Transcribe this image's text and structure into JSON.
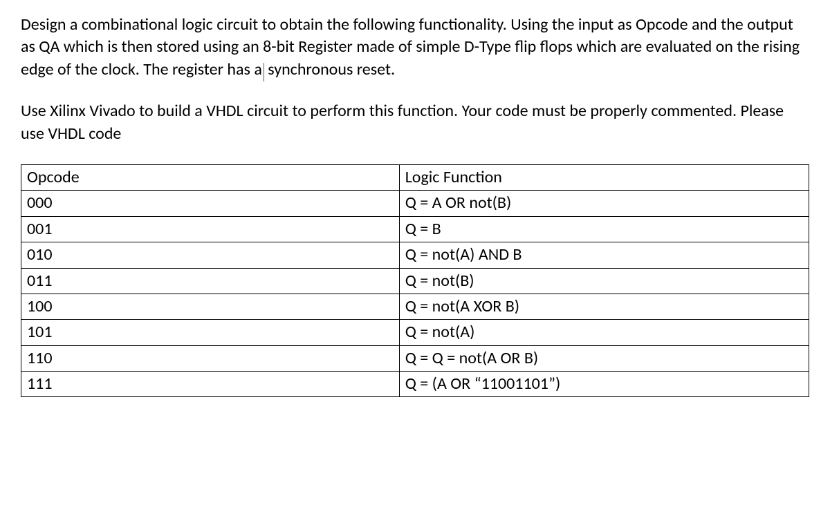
{
  "paragraphs": {
    "p1_part1": "Design a combinational logic circuit to obtain the following functionality. Using the input as Opcode and the output as QA which is then stored using an 8-bit Register made of simple D-Type flip flops which are evaluated on the rising edge of the clock. The register has a",
    "p1_part2": "synchronous reset.",
    "p2": "Use Xilinx Vivado to build a VHDL circuit to perform this function. Your code must be properly commented. Please use VHDL code"
  },
  "table": {
    "header": {
      "col1": "Opcode",
      "col2": "Logic Function"
    },
    "rows": [
      {
        "opcode": "000",
        "func": "Q = A OR not(B)"
      },
      {
        "opcode": "001",
        "func": "Q = B"
      },
      {
        "opcode": "010",
        "func": "Q = not(A)  AND  B"
      },
      {
        "opcode": "011",
        "func": "Q = not(B)"
      },
      {
        "opcode": "100",
        "func": "Q = not(A  XOR  B)"
      },
      {
        "opcode": "101",
        "func": "Q = not(A)"
      },
      {
        "opcode": "110",
        "func": "Q = Q = not(A OR B)"
      },
      {
        "opcode": "111",
        "func": "Q = (A OR “11001101”)"
      }
    ]
  }
}
